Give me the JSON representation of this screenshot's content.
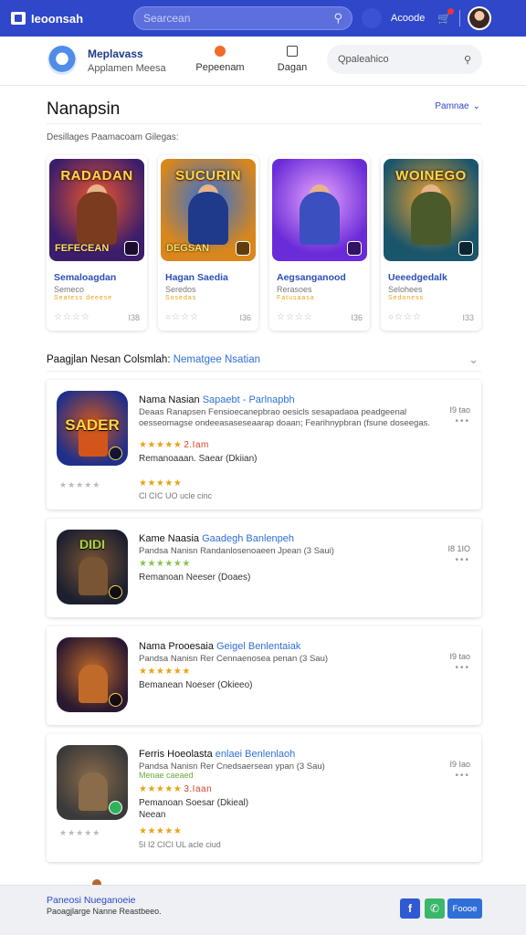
{
  "topbar": {
    "logo_label": "Ieoonsah",
    "search_placeholder": "Searcean",
    "account_label": "Acoode"
  },
  "subheader": {
    "brand_title": "Meplavass",
    "brand_sub": "Applamen Meesa",
    "nav": [
      {
        "label": "Pepeenam"
      },
      {
        "label": "Dagan"
      }
    ],
    "search_placeholder": "Qpaleahico"
  },
  "page": {
    "title": "Nanapsin",
    "sort_label": "Pamnae",
    "section_label": "Desillages Paamacoam Gilegas:"
  },
  "featured": [
    {
      "art_title": "RADADAN",
      "art_foot": "FEFECEAN",
      "name": "Semaloagdan",
      "sub": "Semeco",
      "mini": "Seatess deeese",
      "count": "I38",
      "bg": "#3b1d6b",
      "accent": "#f0562a",
      "fig": "#7a3b1f"
    },
    {
      "art_title": "SUCURIN",
      "art_foot": "DEGSAN",
      "name": "Hagan Saedia",
      "sub": "Seredos",
      "mini": "Sosedas",
      "count": "I36",
      "bg": "#d9871c",
      "accent": "#2f6fd8",
      "fig": "#1f3a8a"
    },
    {
      "art_title": "",
      "art_foot": "",
      "name": "Aegsanganood",
      "sub": "Rerasoes",
      "mini": "Fatusaasa",
      "count": "I36",
      "bg": "#6a2bd8",
      "accent": "#e9a6ff",
      "fig": "#3b4fbf"
    },
    {
      "art_title": "WOINEGO",
      "art_foot": "",
      "name": "Ueeedgedalk",
      "sub": "Selohees",
      "mini": "Sedoness",
      "count": "I33",
      "bg": "#19556b",
      "accent": "#f0a22a",
      "fig": "#4a5a2a"
    }
  ],
  "list": {
    "header_prefix": "Paagjlan Nesan Colsmlah:",
    "header_highlight": "Nematgee Nsatian"
  },
  "rows": [
    {
      "thumb_title": "SADER",
      "thumb_bg": "#1f2f8a",
      "thumb_fig": "#d2561b",
      "title": "Nama Nasian",
      "title_hl": "Sapaebt - Parlnapbh",
      "desc": "Deaas Ranapsen Fensioecanepbrao oesicls sesapadaoa peadgeenal oesseomagse ondeeasaseseaarap doaan; Fearihnypbran (fsune doseegas.",
      "stars_label": "★★★★★",
      "stars_value": "2.Iam",
      "stars2_label": "★★★★★",
      "meta": "Remanoaaan. Saear (Dkiian)",
      "price": "I9 tao",
      "left_rating": "★★★★★",
      "foot": "Cl CIC UO ucle cinc"
    },
    {
      "thumb_title": "DIDI",
      "thumb_bg": "#1b1f2f",
      "thumb_fig": "#7a5533",
      "title": "Kame Naasia",
      "title_hl": "Gaadegh Banlenpeh",
      "desc": "Pandsa Nanisn Randanlosenoaeen Jpean (3 Saui)",
      "stars_label": "★★★★★★",
      "meta": "Remanoan Neeser (Doaes)",
      "price": "I8 1IO"
    },
    {
      "thumb_title": "",
      "thumb_bg": "#2a1930",
      "thumb_fig": "#c06a2a",
      "title": "Nama Prooesaia",
      "title_hl": "Geigel Benlentaiak",
      "desc": "Pandsa Nanisn Rer Cennaenosea penan (3 Sau)",
      "stars_label": "★★★★★★",
      "meta": "Bemanean Noeser (Okieeo)",
      "price": "I9 tao"
    },
    {
      "thumb_title": "",
      "thumb_bg": "#3a3a3a",
      "thumb_fig": "#8a6b4a",
      "title": "Ferris Hoeolasta",
      "title_hl": "enlaei Benlenlaoh",
      "desc": "Pandsa Nanisn Rer Cnedsaersean ypan (3 Sau)",
      "sub_green": "Menae caeaed",
      "stars_label": "★★★★★",
      "stars_value": "3.Iaan",
      "meta": "Pemanoan Soesar (Dkieal)",
      "meta2": "Neean",
      "stars2_label": "★★★★★",
      "price": "I9 Iao",
      "left_rating": "★★★★★",
      "foot": "5I I2 CICI UL acle ciud"
    }
  ],
  "footer": {
    "title": "Paneosi Nueganoeie",
    "sub": "Paoagjlarge Nanne Reastbeeo.",
    "fb_label": "f",
    "follow_label": "Foooe"
  }
}
